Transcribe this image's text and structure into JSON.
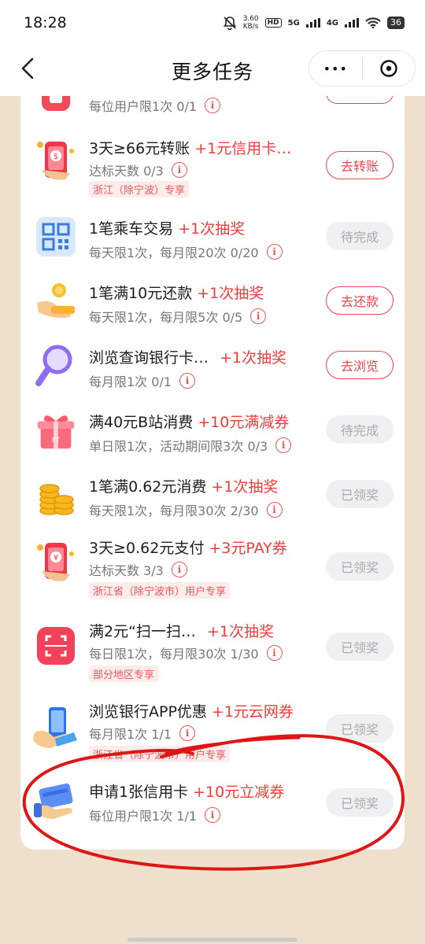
{
  "status": {
    "time": "18:28",
    "speed_top": "3.60",
    "speed_bottom": "KB/s",
    "hd": "HD",
    "net1": "5G",
    "net2": "4G",
    "battery": "36"
  },
  "header": {
    "title": "更多任务",
    "more_glyph": "•••",
    "icons": [
      "back-icon",
      "more-icon",
      "close-circle-icon"
    ]
  },
  "tasks": [
    {
      "title": "",
      "reward": "",
      "sub": "每位用户限1次  0/1",
      "tag": "",
      "button": ""
    },
    {
      "title": "3天≥66元转账",
      "reward": "+1元信用卡…",
      "sub": "达标天数  0/3",
      "tag": "浙江（除宁波）专享",
      "button": "去转账",
      "button_state": "go"
    },
    {
      "title": "1笔乘车交易",
      "reward": "+1次抽奖",
      "sub": "每天限1次，每月限20次  0/20",
      "tag": "",
      "button": "待完成",
      "button_state": "wait"
    },
    {
      "title": "1笔满10元还款",
      "reward": "+1次抽奖",
      "sub": "每天限1次，每月限5次  0/5",
      "tag": "",
      "button": "去还款",
      "button_state": "go"
    },
    {
      "title": "浏览查询银行卡…",
      "reward": "+1次抽奖",
      "sub": "每月限1次  0/1",
      "tag": "",
      "button": "去浏览",
      "button_state": "go"
    },
    {
      "title": "满40元B站消费",
      "reward": "+10元满减券",
      "sub": "单日限1次，活动期间限3次  0/3",
      "tag": "",
      "button": "待完成",
      "button_state": "wait"
    },
    {
      "title": "1笔满0.62元消费",
      "reward": "+1次抽奖",
      "sub": "每天限1次，每月限30次  2/30",
      "tag": "",
      "button": "已领奖",
      "button_state": "done"
    },
    {
      "title": "3天≥0.62元支付",
      "reward": "+3元PAY券",
      "sub": "达标天数  3/3",
      "tag": "浙江省（除宁波市）用户专享",
      "button": "已领奖",
      "button_state": "done"
    },
    {
      "title": "满2元“扫一扫…",
      "reward": "+1次抽奖",
      "sub": "每日限1次，每月限30次  1/30",
      "tag": "部分地区专享",
      "button": "已领奖",
      "button_state": "done"
    },
    {
      "title": "浏览银行APP优惠",
      "reward": "+1元云网券",
      "sub": "每月限1次  1/1",
      "tag": "浙江省（除宁波市）用户专享",
      "button": "已领奖",
      "button_state": "done"
    },
    {
      "title": "申请1张信用卡",
      "reward": "+10元立减券",
      "sub": "每位用户限1次  1/1",
      "tag": "",
      "button": "已领奖",
      "button_state": "done"
    }
  ],
  "colors": {
    "accent": "#e8464c",
    "reward": "#f23c3c",
    "page_bg": "#efdfcd",
    "annotation": "#e01515"
  }
}
